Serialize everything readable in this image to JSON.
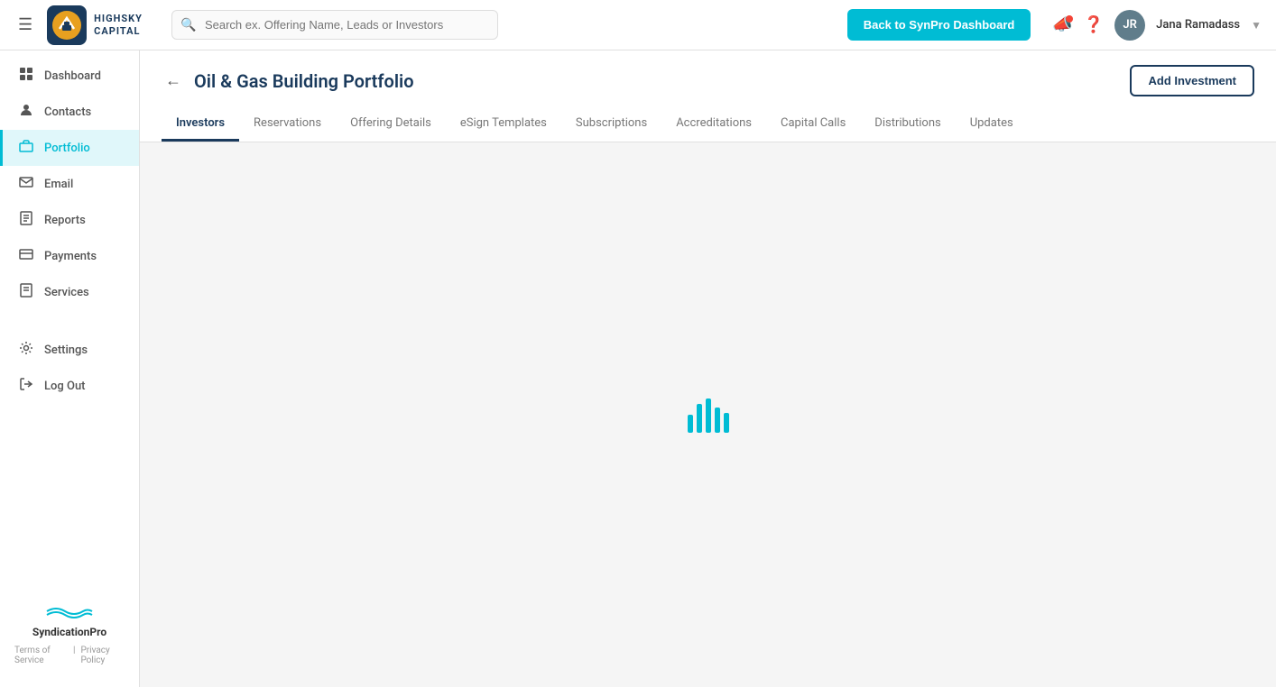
{
  "header": {
    "menu_label": "☰",
    "logo_text": "HIGHSKY",
    "logo_subtext": "capital",
    "search_placeholder": "Search ex. Offering Name, Leads or Investors",
    "back_btn_label": "Back to SynPro Dashboard",
    "user_name": "Jana Ramadass",
    "user_initials": "JR"
  },
  "sidebar": {
    "items": [
      {
        "id": "dashboard",
        "label": "Dashboard",
        "icon": "⊞"
      },
      {
        "id": "contacts",
        "label": "Contacts",
        "icon": "👤"
      },
      {
        "id": "portfolio",
        "label": "Portfolio",
        "icon": "💼",
        "active": true
      },
      {
        "id": "email",
        "label": "Email",
        "icon": "✉"
      },
      {
        "id": "reports",
        "label": "Reports",
        "icon": "📋"
      },
      {
        "id": "payments",
        "label": "Payments",
        "icon": "💳"
      },
      {
        "id": "services",
        "label": "Services",
        "icon": "📄"
      },
      {
        "id": "settings",
        "label": "Settings",
        "icon": "⚙"
      },
      {
        "id": "logout",
        "label": "Log Out",
        "icon": "🚪"
      }
    ],
    "footer": {
      "brand": "SyndicationPro",
      "terms": "Terms of Service",
      "privacy": "Privacy Policy"
    }
  },
  "content": {
    "back_btn_label": "←",
    "title": "Oil & Gas Building Portfolio",
    "add_investment_label": "Add Investment",
    "tabs": [
      {
        "id": "investors",
        "label": "Investors",
        "active": true
      },
      {
        "id": "reservations",
        "label": "Reservations"
      },
      {
        "id": "offering-details",
        "label": "Offering Details"
      },
      {
        "id": "esign-templates",
        "label": "eSign Templates"
      },
      {
        "id": "subscriptions",
        "label": "Subscriptions"
      },
      {
        "id": "accreditations",
        "label": "Accreditations"
      },
      {
        "id": "capital-calls",
        "label": "Capital Calls"
      },
      {
        "id": "distributions",
        "label": "Distributions"
      },
      {
        "id": "updates",
        "label": "Updates"
      }
    ]
  }
}
